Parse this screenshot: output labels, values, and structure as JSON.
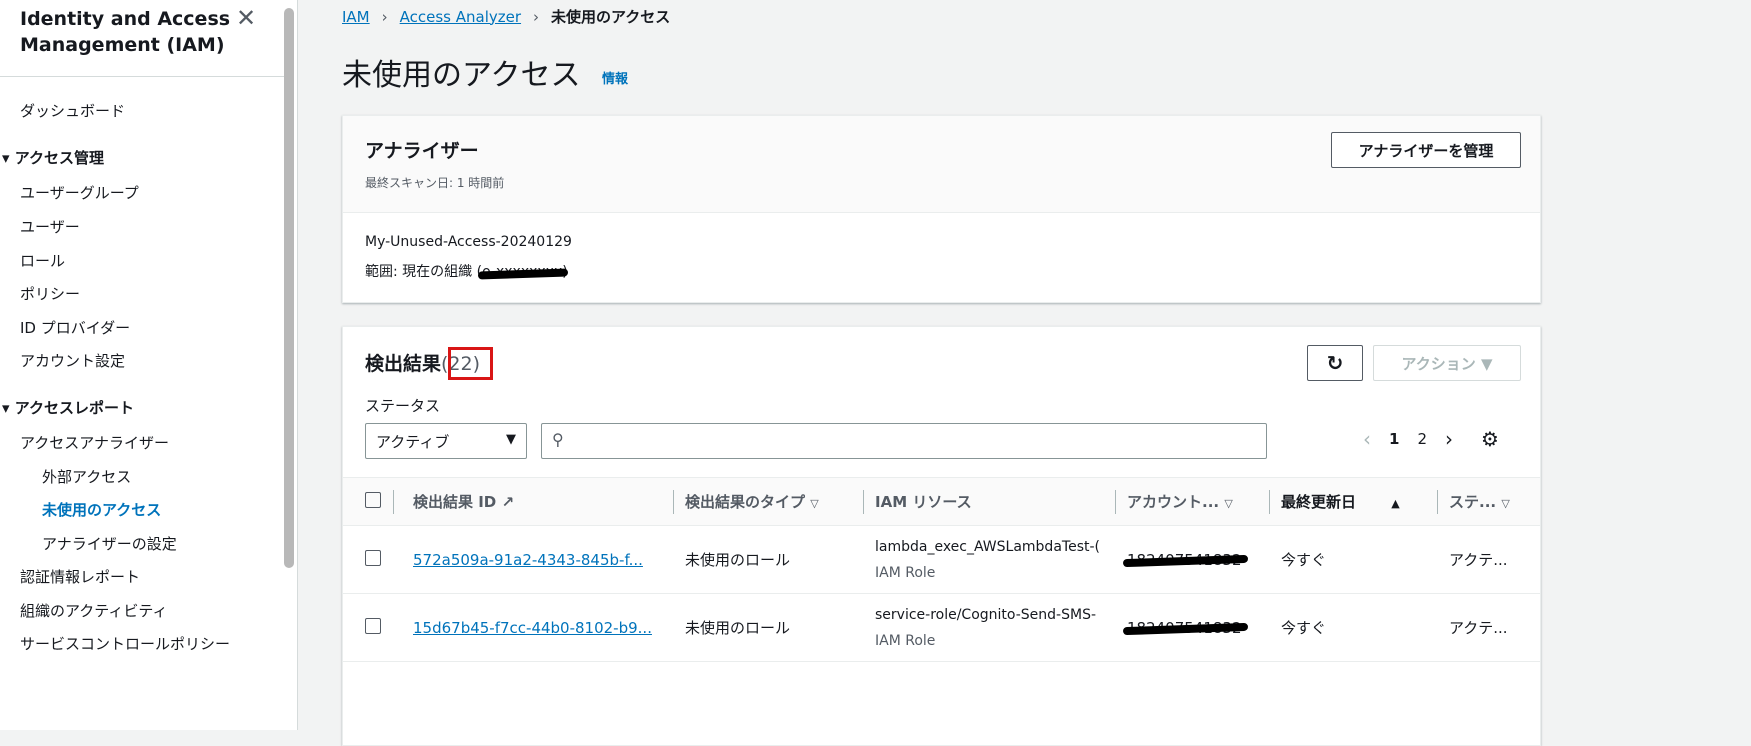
{
  "sidebar": {
    "title": "Identity and Access Management (IAM)",
    "items": [
      {
        "label": "ダッシュボード"
      },
      {
        "label": "アクセス管理"
      },
      {
        "label": "ユーザーグループ"
      },
      {
        "label": "ユーザー"
      },
      {
        "label": "ロール"
      },
      {
        "label": "ポリシー"
      },
      {
        "label": "ID プロバイダー"
      },
      {
        "label": "アカウント設定"
      },
      {
        "label": "アクセスレポート"
      },
      {
        "label": "アクセスアナライザー"
      },
      {
        "label": "外部アクセス"
      },
      {
        "label": "未使用のアクセス"
      },
      {
        "label": "アナライザーの設定"
      },
      {
        "label": "認証情報レポート"
      },
      {
        "label": "組織のアクティビティ"
      },
      {
        "label": "サービスコントロールポリシー"
      }
    ]
  },
  "breadcrumb": [
    "IAM",
    "Access Analyzer",
    "未使用のアクセス"
  ],
  "page": {
    "title": "未使用のアクセス",
    "info": "情報"
  },
  "analyzer": {
    "title": "アナライザー",
    "last_scan": "最終スキャン日: 1 時間前",
    "manage": "アナライザーを管理",
    "name": "My-Unused-Access-20240129",
    "scope": "範囲: 現在の組織 (",
    "scope_redacted": "o-xxxxxxxx",
    ")": ")"
  },
  "findings": {
    "title": "検出結果",
    "count": "(22)",
    "actions": "アクション ▼",
    "status_label": "ステータス",
    "status_value": "アクティブ",
    "search_placeholder": "",
    "pages": [
      "1",
      "2"
    ],
    "columns": [
      "検出結果 ID",
      "検出結果のタイプ",
      "IAM リソース",
      "アカウント...",
      "最終更新日",
      "ステ..."
    ],
    "rows": [
      {
        "id": "572a509a-91a2-4343-845b-f...",
        "type": "未使用のロール",
        "resource": "lambda_exec_AWSLambdaTest-(",
        "resource_type": "IAM Role",
        "account": "182407541832",
        "updated": "今すぐ",
        "status": "アクテ..."
      },
      {
        "id": "15d67b45-f7cc-44b0-8102-b9...",
        "type": "未使用のロール",
        "resource": "service-role/Cognito-Send-SMS-",
        "resource_type": "IAM Role",
        "account": "182407541832",
        "updated": "今すぐ",
        "status": "アクテ..."
      }
    ]
  }
}
